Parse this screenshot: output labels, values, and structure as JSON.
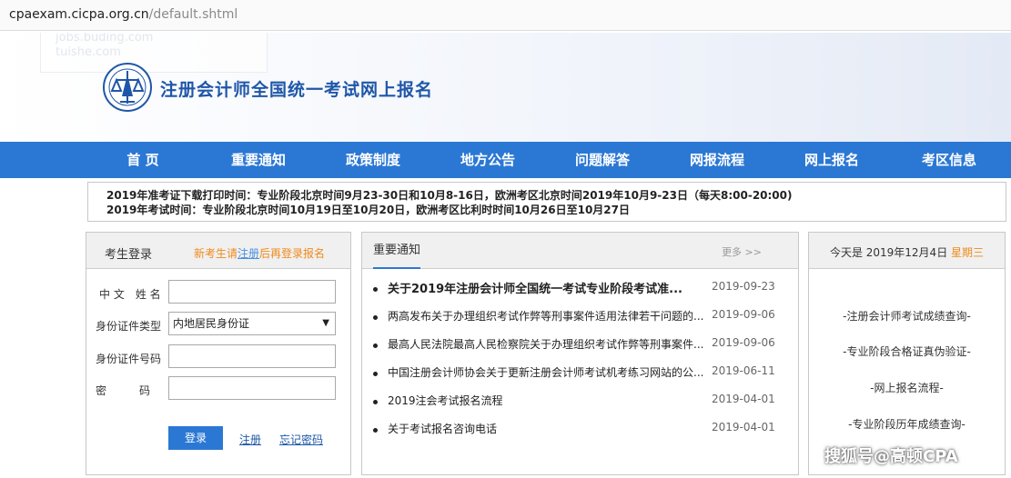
{
  "browser": {
    "url_host": "cpaexam.cicpa.org.cn",
    "url_path": "/default.shtml",
    "ghost_lines": [
      "jobs.buding.com",
      "tuishe.com"
    ]
  },
  "header": {
    "site_title": "注册会计师全国统一考试网上报名"
  },
  "nav": {
    "items": [
      "首 页",
      "重要通知",
      "政策制度",
      "地方公告",
      "问题解答",
      "网报流程",
      "网上报名",
      "考区信息"
    ]
  },
  "ticker": {
    "lines": [
      "2019年准考证下载打印时间：专业阶段北京时间9月23-30日和10月8-16日，欧洲考区北京时间2019年10月9-23日（每天8:00-20:00)",
      "2019年考试时间：专业阶段北京时间10月19日至10月20日，欧洲考区比利时时间10月26日至10月27日"
    ]
  },
  "login": {
    "title": "考生登录",
    "tip_prefix": "新考生请",
    "tip_link": "注册",
    "tip_suffix": "后再登录报名",
    "name_label": "中 文　姓 名",
    "id_type_label": "身份证件类型",
    "id_type_value": "内地居民身份证",
    "id_type_arrow": "▼",
    "id_number_label": "身份证件号码",
    "password_label": "密　　　码",
    "login_button": "登录",
    "register_link": "注册",
    "forgot_link": "忘记密码"
  },
  "news": {
    "title": "重要通知",
    "more": "更多 >>",
    "items": [
      {
        "title": "关于2019年注册会计师全国统一考试专业阶段考试准...",
        "date": "2019-09-23"
      },
      {
        "title": "两高发布关于办理组织考试作弊等刑事案件适用法律若干问题的...",
        "date": "2019-09-06"
      },
      {
        "title": "最高人民法院最高人民检察院关于办理组织考试作弊等刑事案件...",
        "date": "2019-09-06"
      },
      {
        "title": "中国注册会计师协会关于更新注册会计师考试机考练习网站的公...",
        "date": "2019-06-11"
      },
      {
        "title": "2019注会考试报名流程",
        "date": "2019-04-01"
      },
      {
        "title": "关于考试报名咨询电话",
        "date": "2019-04-01"
      }
    ]
  },
  "side": {
    "date_prefix": "今天是 2019年12月4日",
    "weekday": "星期三",
    "links": [
      "-注册会计师考试成绩查询-",
      "-专业阶段合格证真伪验证-",
      "-网上报名流程-",
      "-专业阶段历年成绩查询-"
    ]
  },
  "watermark": "搜狐号@高顿CPA",
  "colors": {
    "accent": "#2b78d4",
    "title_blue": "#1f57a8",
    "orange": "#f08a1a"
  }
}
